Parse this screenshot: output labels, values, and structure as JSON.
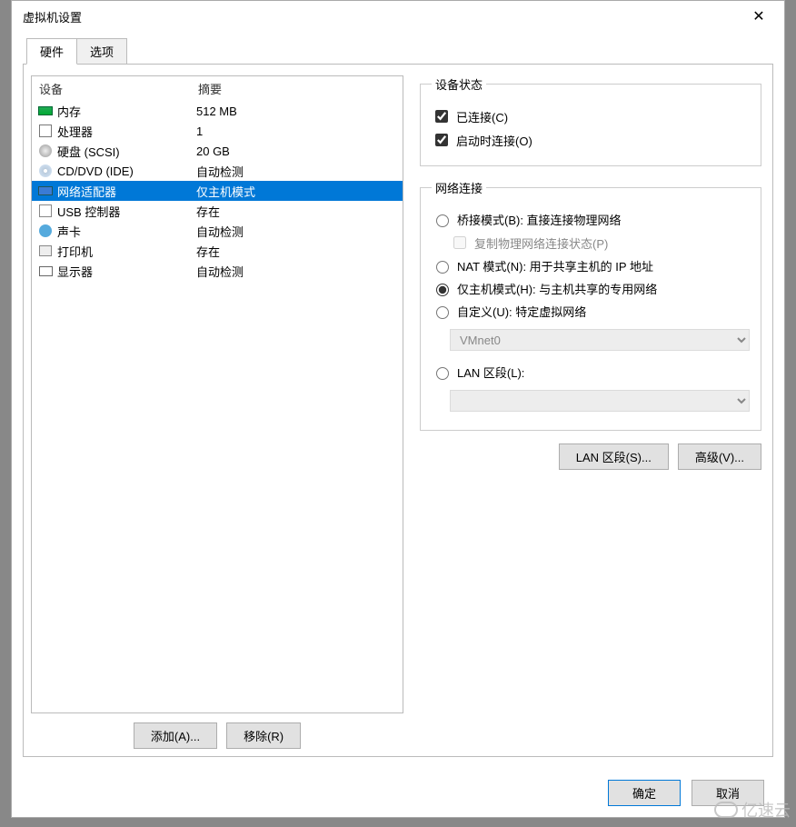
{
  "title": "虚拟机设置",
  "tabs": {
    "hardware": "硬件",
    "options": "选项"
  },
  "list_header": {
    "device": "设备",
    "summary": "摘要"
  },
  "devices": [
    {
      "name": "内存",
      "summary": "512 MB",
      "icon": "memory"
    },
    {
      "name": "处理器",
      "summary": "1",
      "icon": "cpu"
    },
    {
      "name": "硬盘 (SCSI)",
      "summary": "20 GB",
      "icon": "disk"
    },
    {
      "name": "CD/DVD (IDE)",
      "summary": "自动检测",
      "icon": "cd"
    },
    {
      "name": "网络适配器",
      "summary": "仅主机模式",
      "icon": "net",
      "selected": true
    },
    {
      "name": "USB 控制器",
      "summary": "存在",
      "icon": "usb"
    },
    {
      "name": "声卡",
      "summary": "自动检测",
      "icon": "sound"
    },
    {
      "name": "打印机",
      "summary": "存在",
      "icon": "printer"
    },
    {
      "name": "显示器",
      "summary": "自动检测",
      "icon": "display"
    }
  ],
  "left_buttons": {
    "add": "添加(A)...",
    "remove": "移除(R)"
  },
  "right": {
    "device_state": {
      "legend": "设备状态",
      "connected": "已连接(C)",
      "connect_at_poweron": "启动时连接(O)"
    },
    "network": {
      "legend": "网络连接",
      "bridged": "桥接模式(B): 直接连接物理网络",
      "replicate": "复制物理网络连接状态(P)",
      "nat": "NAT 模式(N): 用于共享主机的 IP 地址",
      "hostonly": "仅主机模式(H): 与主机共享的专用网络",
      "custom": "自定义(U): 特定虚拟网络",
      "custom_value": "VMnet0",
      "lan_segment": "LAN 区段(L):",
      "lan_value": ""
    },
    "buttons": {
      "lan_segments": "LAN 区段(S)...",
      "advanced": "高级(V)..."
    }
  },
  "footer": {
    "ok": "确定",
    "cancel": "取消"
  },
  "watermark": "亿速云"
}
